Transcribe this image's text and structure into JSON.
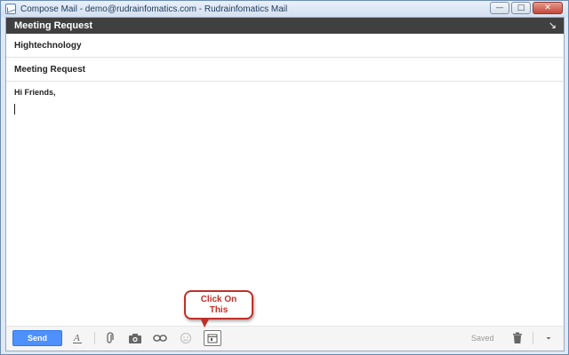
{
  "window": {
    "title": "Compose Mail - demo@rudrainfomatics.com - Rudrainfomatics Mail",
    "minimize_glyph": "—",
    "maximize_glyph": "□",
    "close_glyph": "✕"
  },
  "compose": {
    "header_title": "Meeting Request",
    "expand_glyph": "↘",
    "to_value": "Hightechnology",
    "subject_value": "Meeting Request",
    "body_text": "Hi Friends,"
  },
  "toolbar": {
    "send_label": "Send",
    "saved_label": "Saved",
    "icons": [
      "formatting-icon",
      "attach-icon",
      "camera-icon",
      "link-icon",
      "emoji-icon",
      "calendar-icon",
      "trash-icon",
      "more-options-icon"
    ]
  },
  "callout": {
    "text_line1": "Click On",
    "text_line2": "This",
    "color": "#c0302a"
  },
  "colors": {
    "send_button": "#4d90fe",
    "header_bar": "#404040"
  }
}
